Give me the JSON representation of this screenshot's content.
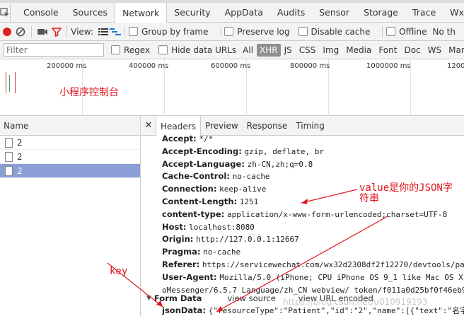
{
  "window": {
    "top_strip_text": "Chrome devtools"
  },
  "tabs": [
    {
      "label": "Console",
      "active": false
    },
    {
      "label": "Sources",
      "active": false
    },
    {
      "label": "Network",
      "active": true
    },
    {
      "label": "Security",
      "active": false
    },
    {
      "label": "AppData",
      "active": false
    },
    {
      "label": "Audits",
      "active": false
    },
    {
      "label": "Sensor",
      "active": false
    },
    {
      "label": "Storage",
      "active": false
    },
    {
      "label": "Trace",
      "active": false
    },
    {
      "label": "Wxml",
      "active": false
    }
  ],
  "toolbar": {
    "view_label": "View:",
    "group_by_frame": "Group by frame",
    "preserve_log": "Preserve log",
    "disable_cache": "Disable cache",
    "offline": "Offline",
    "throttling": "No th",
    "record_color": "#e02020",
    "filter_color": "#e02020"
  },
  "filterbar": {
    "placeholder": "Filter",
    "regex": "Regex",
    "hide_data_urls": "Hide data URLs",
    "types": [
      "All",
      "XHR",
      "JS",
      "CSS",
      "Img",
      "Media",
      "Font",
      "Doc",
      "WS",
      "Manifest"
    ],
    "active_type": "XHR"
  },
  "overview": {
    "ticks": [
      "200000 ms",
      "400000 ms",
      "600000 ms",
      "800000 ms",
      "1000000 ms",
      "12000"
    ],
    "note": "小程序控制台"
  },
  "requests": {
    "column_name": "Name",
    "rows": [
      {
        "name": "2",
        "selected": false
      },
      {
        "name": "2",
        "selected": false
      },
      {
        "name": "2",
        "selected": true
      }
    ]
  },
  "detail": {
    "tabs": [
      "Headers",
      "Preview",
      "Response",
      "Timing"
    ],
    "active_tab": "Headers",
    "headers": [
      {
        "key": "Accept:",
        "value": "*/*"
      },
      {
        "key": "Accept-Encoding:",
        "value": "gzip, deflate, br"
      },
      {
        "key": "Accept-Language:",
        "value": "zh-CN,zh;q=0.8"
      },
      {
        "key": "Cache-Control:",
        "value": "no-cache"
      },
      {
        "key": "Connection:",
        "value": "keep-alive"
      },
      {
        "key": "Content-Length:",
        "value": "1251"
      },
      {
        "key": "content-type:",
        "value": "application/x-www-form-urlencoded;charset=UTF-8"
      },
      {
        "key": "Host:",
        "value": "localhost:8080"
      },
      {
        "key": "Origin:",
        "value": "http://127.0.0.1:12667"
      },
      {
        "key": "Pragma:",
        "value": "no-cache"
      },
      {
        "key": "Referer:",
        "value": "https://servicewechat.com/wx32d2308df2f12270/devtools/pag"
      },
      {
        "key": "User-Agent:",
        "value": "Mozilla/5.0 (iPhone; CPU iPhone OS 9_1 like Mac OS X)"
      },
      {
        "key": "",
        "value": "oMessenger/6.5.7 Language/zh_CN webview/ token/f011a0d25bf0f46eb9"
      }
    ],
    "form_data": {
      "title": "Form Data",
      "view_source": "view source",
      "view_url_encoded": "view URL encoded",
      "key": "jsonData:",
      "value": "{\"resourceType\":\"Patient\",\"id\":\"2\",\"name\":[{\"text\":\"名字"
    }
  },
  "annotations": {
    "value_note_line1": "value是你的JSON字",
    "value_note_line2": "符串",
    "key_note": "key",
    "color": "#e0141e"
  },
  "watermark": "https://blog.csdn.net/u010919193"
}
